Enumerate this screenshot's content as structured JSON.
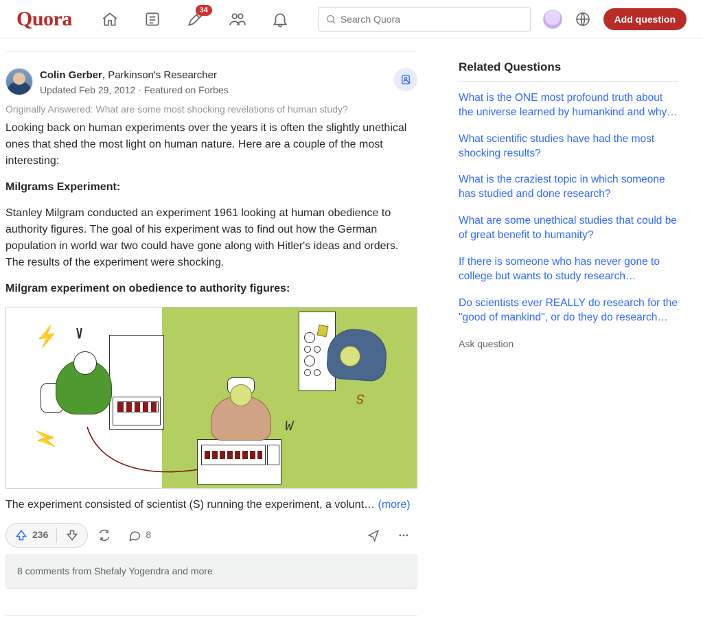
{
  "header": {
    "logo_text": "Quora",
    "notifications_badge": "34",
    "search_placeholder": "Search Quora",
    "add_question_label": "Add question"
  },
  "answer": {
    "author_name": "Colin Gerber",
    "author_credential": ", Parkinson's Researcher",
    "updated_line": "Updated Feb 29, 2012 · Featured on Forbes",
    "originally_answered": "Originally Answered: What are some most shocking revelations of human study?",
    "para_intro": "Looking back on human experiments over the years it is often the slightly unethical ones that shed the most light on human nature. Here are a couple of the most interesting:",
    "heading1": "Milgrams Experiment:",
    "para2": "Stanley Milgram conducted an experiment 1961 looking at human obedience to authority figures. The goal of his experiment was to find out how the German population in world war two could have gone along with Hitler's ideas and orders. The results of the experiment were shocking.",
    "heading2": "Milgram experiment on obedience to authority figures:",
    "truncated_line": "The experiment consisted of scientist (S) running the experiment, a volunt… ",
    "more_label": "(more)",
    "upvote_count": "236",
    "comment_count": "8",
    "comments_bar": "8 comments from Shefaly Yogendra and more"
  },
  "sidebar": {
    "title": "Related Questions",
    "links": [
      "What is the ONE most profound truth about the universe learned by humankind and why…",
      "What scientific studies have had the most shocking results?",
      "What is the craziest topic in which someone has studied and done research?",
      "What are some unethical studies that could be of great benefit to humanity?",
      "If there is someone who has never gone to college but wants to study research…",
      "Do scientists ever REALLY do research for the \"good of mankind\", or do they do research…"
    ],
    "ask_label": "Ask question"
  }
}
